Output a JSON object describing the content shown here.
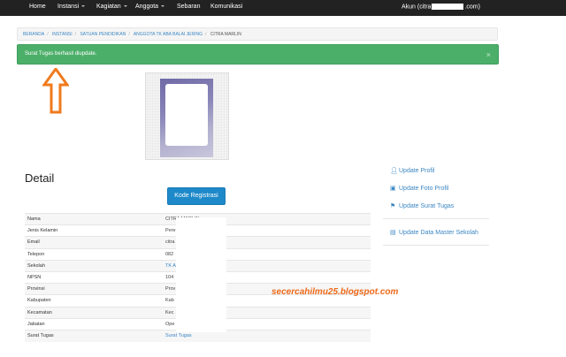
{
  "navbar": {
    "items": [
      {
        "label": "Home",
        "dropdown": false
      },
      {
        "label": "Instansi",
        "dropdown": true
      },
      {
        "label": "Kagiatan",
        "dropdown": true
      },
      {
        "label": "Anggota",
        "dropdown": true
      },
      {
        "label": "Sebaran",
        "dropdown": false
      },
      {
        "label": "Komunikasi",
        "dropdown": false
      }
    ],
    "account_prefix": "Akun (citra",
    "account_suffix": ".com)"
  },
  "breadcrumb": {
    "items": [
      "BERANDA",
      "INSTANSI",
      "SATUAN PENDIDIKAN",
      "ANGGOTA TK ABA BALAI JERING"
    ],
    "active": "CITRA MARLIN"
  },
  "alert": {
    "message": "Surat Tugas berhasil diupdate.",
    "close": "×"
  },
  "detail": {
    "title": "Detail",
    "register_button": "Kode Registrasi",
    "rows": [
      {
        "label": "Nama",
        "value": "CITRA MARLIN",
        "link": false
      },
      {
        "label": "Jenis Kelamin",
        "value": "Pere",
        "link": false
      },
      {
        "label": "Email",
        "value": "citra",
        "link": false
      },
      {
        "label": "Telepon",
        "value": "082",
        "link": false
      },
      {
        "label": "Sekolah",
        "value": "TK A",
        "link": true
      },
      {
        "label": "NPSN",
        "value": "104",
        "link": false
      },
      {
        "label": "Provinsi",
        "value": "Prov",
        "link": false
      },
      {
        "label": "Kabupaten",
        "value": "Kab",
        "link": false
      },
      {
        "label": "Kecamatan",
        "value": "Kec",
        "link": false
      },
      {
        "label": "Jabatan",
        "value": "Ope",
        "link": false
      },
      {
        "label": "Surat Tugas",
        "value": "Surat Tugas",
        "link": true
      }
    ]
  },
  "sidebar": {
    "links": [
      {
        "label": "Update Profil",
        "icon": "user-icon"
      },
      {
        "label": "Update Foto Profil",
        "icon": "camera-icon"
      },
      {
        "label": "Update Surat Tugas",
        "icon": "flag-icon"
      },
      {
        "label": "Update Data Master Sekolah",
        "icon": "image-icon"
      }
    ]
  },
  "watermark": "secercahilmu25.blogspot.com",
  "colors": {
    "navbar": "#222222",
    "alert": "#4caf69",
    "primary": "#1e89c9",
    "link": "#3c87c3",
    "annotation_arrow": "#f07a1c"
  }
}
